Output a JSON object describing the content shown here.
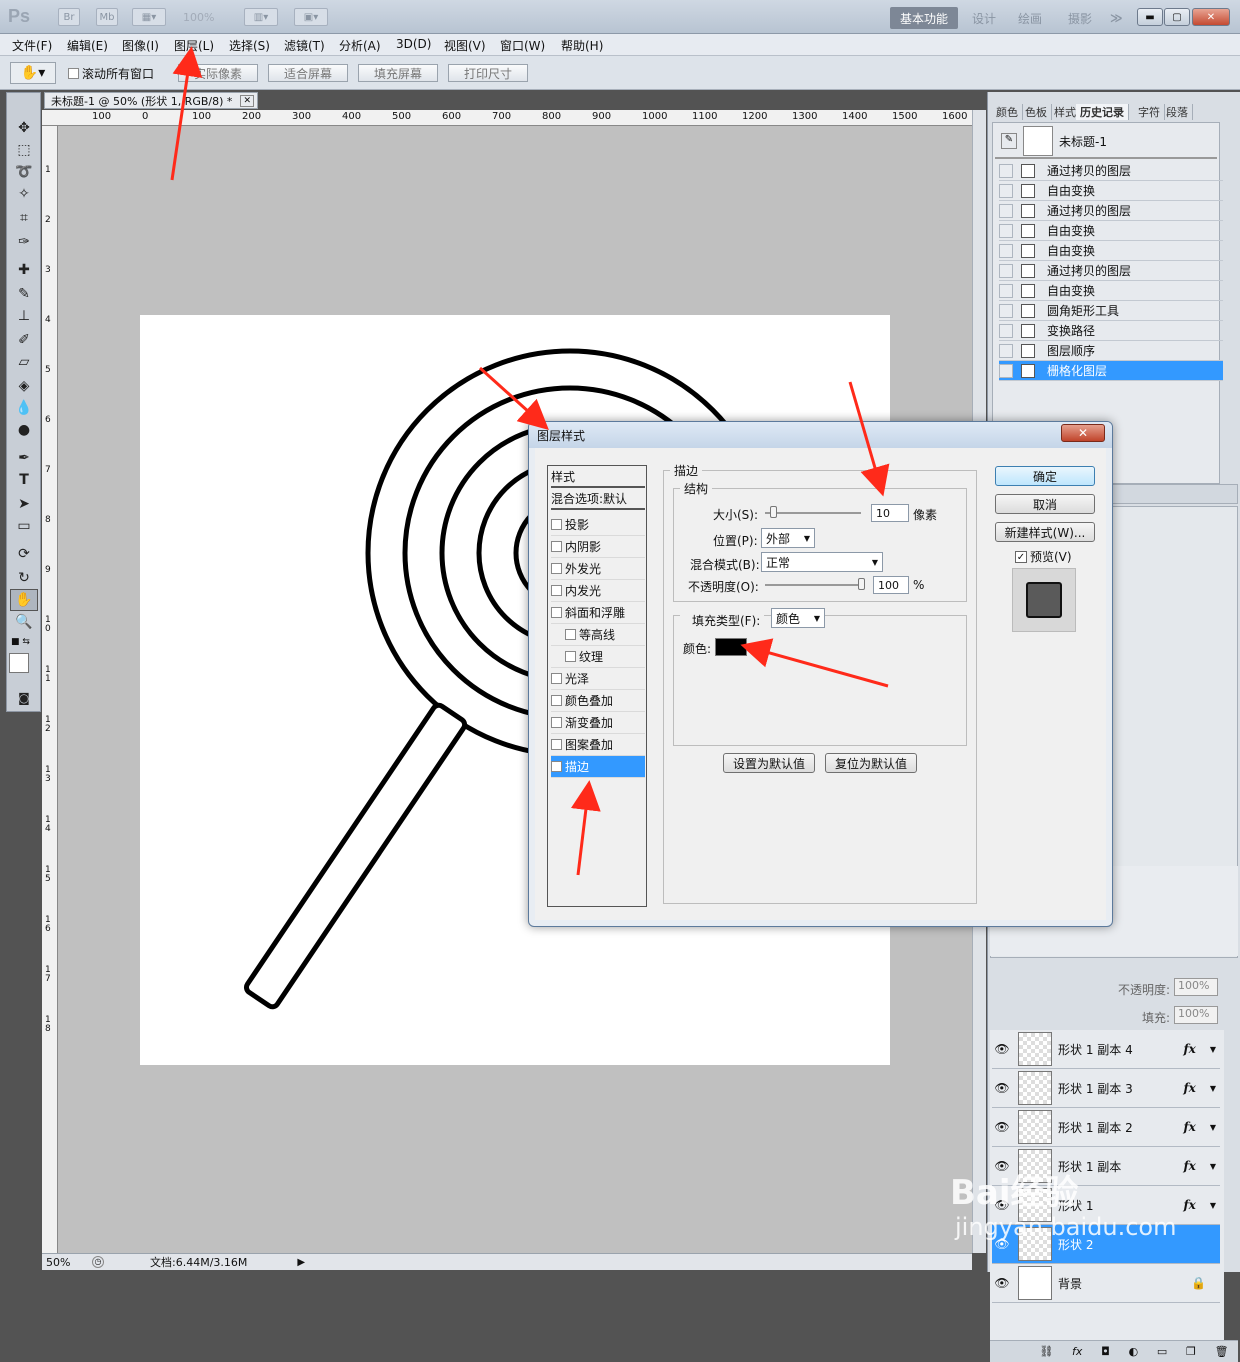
{
  "app": {
    "logo": "Ps",
    "mini_buttons": [
      "Br",
      "Mb"
    ],
    "zoom_display": "100%",
    "workspaces": [
      "基本功能",
      "设计",
      "绘画",
      "摄影"
    ],
    "more": "≫"
  },
  "menu": [
    "文件(F)",
    "编辑(E)",
    "图像(I)",
    "图层(L)",
    "选择(S)",
    "滤镜(T)",
    "分析(A)",
    "3D(D)",
    "视图(V)",
    "窗口(W)",
    "帮助(H)"
  ],
  "options": {
    "scroll_all": "滚动所有窗口",
    "buttons": [
      "实际像素",
      "适合屏幕",
      "填充屏幕",
      "打印尺寸"
    ]
  },
  "document": {
    "tab_title": "未标题-1 @ 50% (形状 1, RGB/8) *",
    "ruler_labels": [
      "100",
      "0",
      "100",
      "200",
      "300",
      "400",
      "500",
      "600",
      "700",
      "800",
      "900",
      "1000",
      "1100",
      "1200",
      "1300",
      "1400",
      "1500",
      "1600"
    ],
    "left_ruler_labels": [
      "1",
      "2",
      "3",
      "4",
      "5",
      "6",
      "7",
      "8",
      "9",
      "1\n0",
      "1\n1",
      "1\n2",
      "1\n3",
      "1\n4",
      "1\n5",
      "1\n6",
      "1\n7",
      "1\n8"
    ],
    "zoom": "50%",
    "doc_size": "文档:6.44M/3.16M"
  },
  "history_panel": {
    "tabs": [
      "颜色",
      "色板",
      "样式",
      "历史记录",
      "字符",
      "段落"
    ],
    "snapshot": "未标题-1",
    "items": [
      "通过拷贝的图层",
      "自由变换",
      "通过拷贝的图层",
      "自由变换",
      "自由变换",
      "通过拷贝的图层",
      "自由变换",
      "圆角矩形工具",
      "变换路径",
      "图层顺序",
      "栅格化图层"
    ]
  },
  "layers_panel": {
    "opacity_label": "不透明度:",
    "opacity": "100%",
    "fill_label": "填充:",
    "fill": "100%",
    "layers": [
      {
        "name": "形状 1 副本 4",
        "fx": "fx"
      },
      {
        "name": "形状 1 副本 3",
        "fx": "fx"
      },
      {
        "name": "形状 1 副本 2",
        "fx": "fx"
      },
      {
        "name": "形状 1 副本",
        "fx": "fx"
      },
      {
        "name": "形状 1",
        "fx": "fx"
      },
      {
        "name": "形状 2",
        "fx": ""
      },
      {
        "name": "背景",
        "fx": ""
      }
    ],
    "footer_icons": [
      "link-icon",
      "fx-icon",
      "mask-icon",
      "adjustment-icon",
      "group-icon",
      "new-layer-icon",
      "trash-icon"
    ]
  },
  "dialog": {
    "title": "图层样式",
    "close": "✕",
    "style_list": [
      {
        "label": "样式",
        "check": false,
        "header": true
      },
      {
        "label": "混合选项:默认",
        "check": false,
        "header": true
      },
      {
        "label": "投影",
        "check": false
      },
      {
        "label": "内阴影",
        "check": false
      },
      {
        "label": "外发光",
        "check": false
      },
      {
        "label": "内发光",
        "check": false
      },
      {
        "label": "斜面和浮雕",
        "check": false
      },
      {
        "label": "等高线",
        "check": false,
        "indent": true
      },
      {
        "label": "纹理",
        "check": false,
        "indent": true
      },
      {
        "label": "光泽",
        "check": false
      },
      {
        "label": "颜色叠加",
        "check": false
      },
      {
        "label": "渐变叠加",
        "check": false
      },
      {
        "label": "图案叠加",
        "check": false
      },
      {
        "label": "描边",
        "check": true,
        "selected": true
      }
    ],
    "stroke": {
      "group_title": "描边",
      "structure_title": "结构",
      "size_label": "大小(S):",
      "size_value": "10",
      "size_unit": "像素",
      "position_label": "位置(P):",
      "position_value": "外部",
      "blend_label": "混合模式(B):",
      "blend_value": "正常",
      "opacity_label": "不透明度(O):",
      "opacity_value": "100",
      "opacity_unit": "%",
      "fill_type_label": "填充类型(F):",
      "fill_type_value": "颜色",
      "color_label": "颜色:",
      "color": "#000000",
      "set_default": "设置为默认值",
      "reset_default": "复位为默认值"
    },
    "buttons": {
      "ok": "确定",
      "cancel": "取消",
      "new_style": "新建样式(W)...",
      "preview": "预览(V)"
    },
    "preview_checked": true
  },
  "annotation_color": "#ff2a1a",
  "watermark": {
    "line1": "Bai",
    "line1b": "经验",
    "line2": "jingyan.baidu.com"
  }
}
